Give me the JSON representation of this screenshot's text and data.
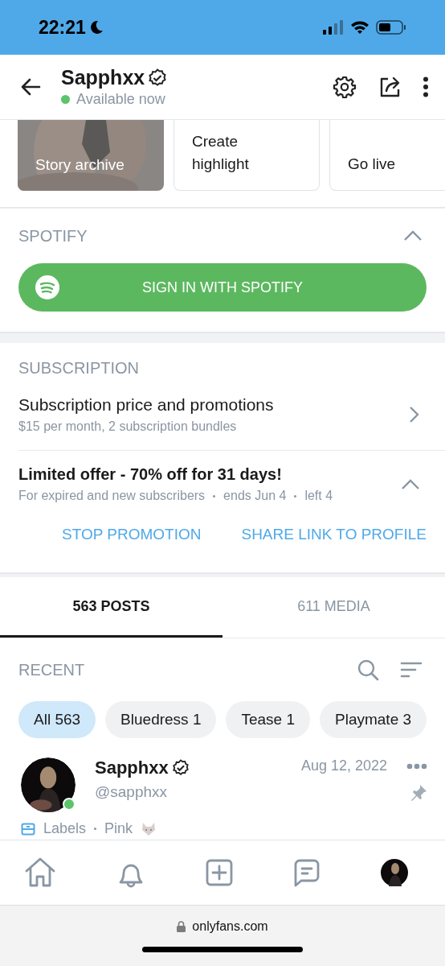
{
  "status_bar": {
    "time": "22:21"
  },
  "header": {
    "name": "Sapphxx",
    "verified": true,
    "status": "Available now",
    "online": true
  },
  "story_tiles": [
    {
      "kind": "picture",
      "label": "Story archive"
    },
    {
      "kind": "action",
      "label": "Create highlight"
    },
    {
      "kind": "action",
      "label": "Go live"
    }
  ],
  "spotify": {
    "title": "SPOTIFY",
    "expanded": true,
    "button": "SIGN IN WITH SPOTIFY"
  },
  "subscription": {
    "title": "SUBSCRIPTION",
    "price_title": "Subscription price and promotions",
    "price_detail": "$15 per month, 2 subscription bundles",
    "offer": {
      "title": "Limited offer - 70% off for 31 days!",
      "details": [
        "For expired and new subscribers",
        "ends Jun 4",
        "left 4"
      ],
      "expanded": true
    },
    "actions": [
      "STOP PROMOTION",
      "SHARE LINK TO PROFILE"
    ]
  },
  "tabs": [
    {
      "label": "563 POSTS",
      "selected": true
    },
    {
      "label": "611 MEDIA",
      "selected": false
    }
  ],
  "recent": {
    "title": "RECENT"
  },
  "chips": [
    {
      "label": "All 563",
      "selected": true
    },
    {
      "label": "Bluedress 1",
      "selected": false
    },
    {
      "label": "Tease 1",
      "selected": false
    },
    {
      "label": "Playmate 3",
      "selected": false
    }
  ],
  "post": {
    "name": "Sapphxx",
    "verified": true,
    "handle": "@sapphxx",
    "date": "Aug 12, 2022",
    "online": true,
    "pinned": true,
    "labels": [
      "Labels",
      "Pink"
    ]
  },
  "browser": {
    "url": "onlyfans.com"
  }
}
